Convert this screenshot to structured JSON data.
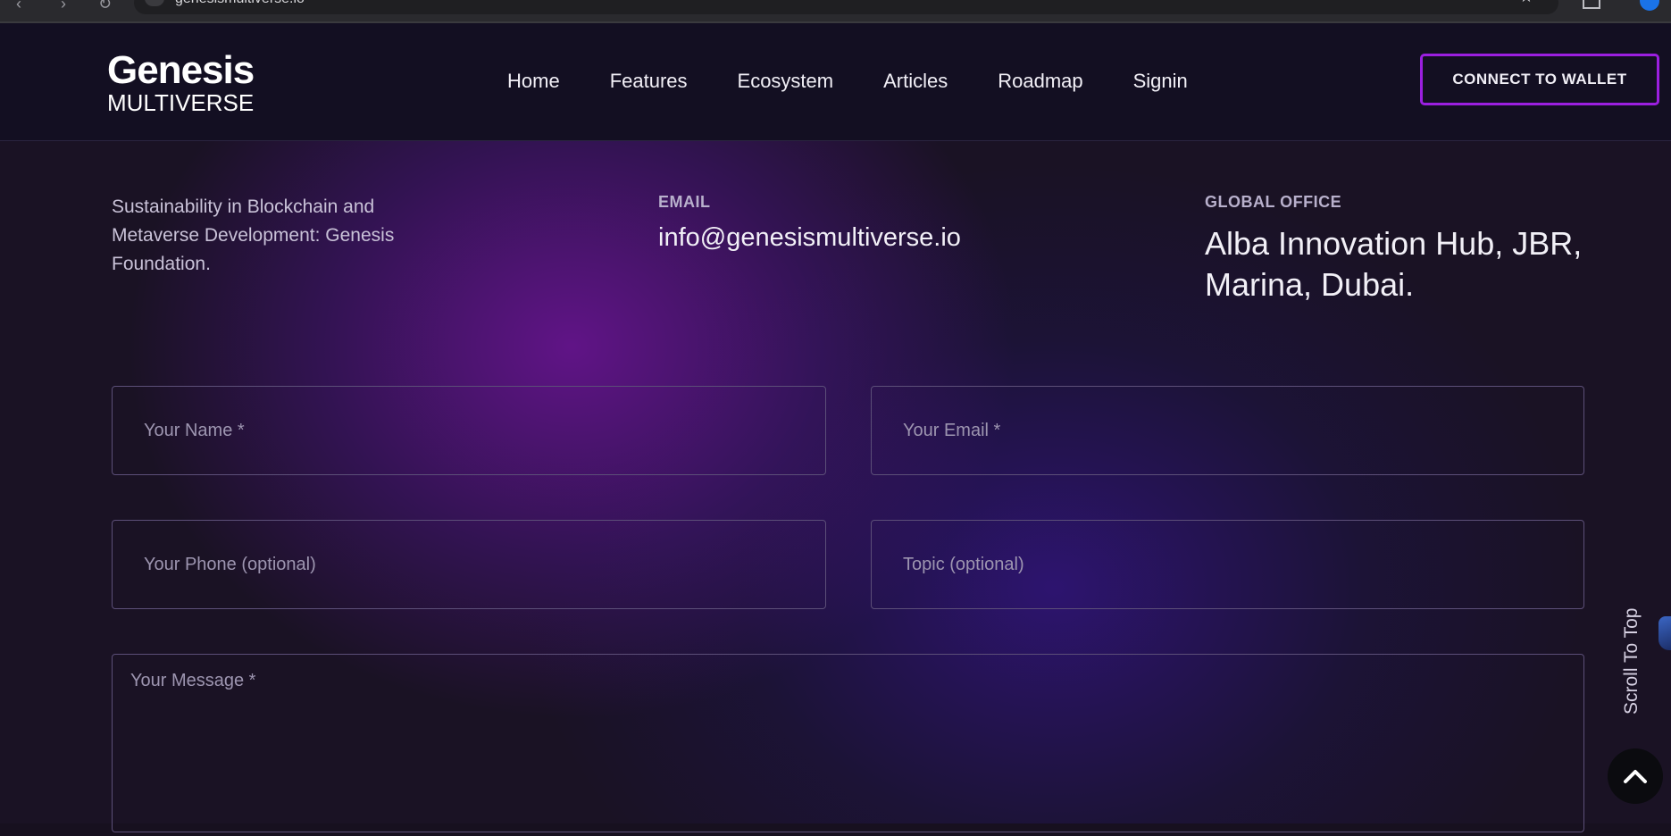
{
  "browser": {
    "url": "genesismultiverse.io",
    "back_icon": "back-arrow-icon",
    "forward_icon": "forward-arrow-icon",
    "reload_icon": "reload-icon",
    "bookmark_icon": "star-icon"
  },
  "header": {
    "logo_word": "Genesis",
    "logo_sub": "MULTIVERSE",
    "nav": [
      "Home",
      "Features",
      "Ecosystem",
      "Articles",
      "Roadmap",
      "Signin"
    ],
    "cta_label": "CONNECT TO WALLET",
    "accent": "#9b1fe0"
  },
  "contact": {
    "intro": "Sustainability in Blockchain and Metaverse Development: Genesis Foundation.",
    "email_label": "EMAIL",
    "email_value": "info@genesismultiverse.io",
    "office_label": "GLOBAL OFFICE",
    "office_value": "Alba Innovation Hub, JBR, Marina, Dubai."
  },
  "form": {
    "name_placeholder": "Your Name *",
    "email_placeholder": "Your Email *",
    "phone_placeholder": "Your Phone (optional)",
    "topic_placeholder": "Topic (optional)",
    "message_placeholder": "Your Message *"
  },
  "scroll_top": {
    "label": "Scroll To Top",
    "icon": "chevron-up-icon"
  }
}
